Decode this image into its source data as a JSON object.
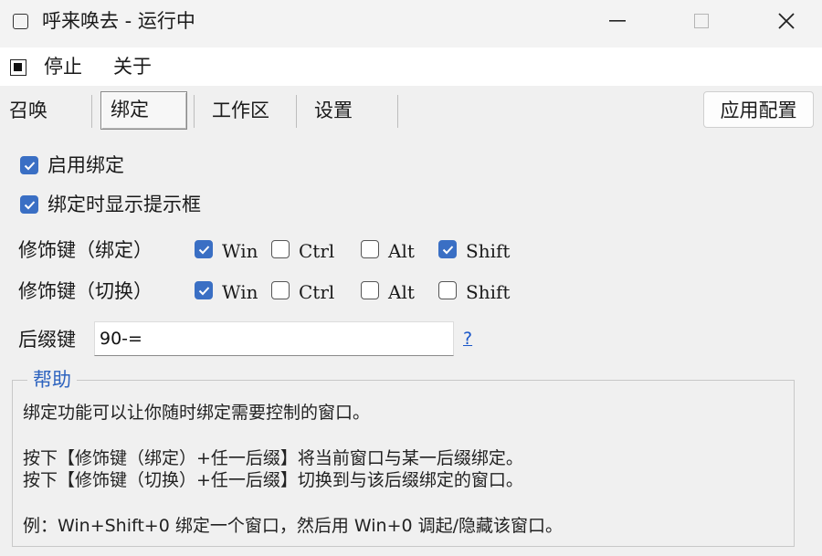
{
  "window": {
    "title": "呼来唤去 - 运行中",
    "minimize_icon": "minimize-icon",
    "maximize_icon": "maximize-icon",
    "close_icon": "close-icon"
  },
  "menu": {
    "stop_label": "停止",
    "about_label": "关于"
  },
  "tabs": [
    {
      "label": "召唤",
      "active": false
    },
    {
      "label": "绑定",
      "active": true
    },
    {
      "label": "工作区",
      "active": false
    },
    {
      "label": "设置",
      "active": false
    }
  ],
  "apply_button": "应用配置",
  "options": {
    "enable_bind": {
      "label": "启用绑定",
      "checked": true
    },
    "show_tip": {
      "label": "绑定时显示提示框",
      "checked": true
    }
  },
  "modifier_bind": {
    "label": "修饰键（绑定）",
    "keys": [
      {
        "name": "Win",
        "checked": true
      },
      {
        "name": "Ctrl",
        "checked": false
      },
      {
        "name": "Alt",
        "checked": false
      },
      {
        "name": "Shift",
        "checked": true
      }
    ]
  },
  "modifier_switch": {
    "label": "修饰键（切换）",
    "keys": [
      {
        "name": "Win",
        "checked": true
      },
      {
        "name": "Ctrl",
        "checked": false
      },
      {
        "name": "Alt",
        "checked": false
      },
      {
        "name": "Shift",
        "checked": false
      }
    ]
  },
  "suffix": {
    "label": "后缀键",
    "value": "90-=",
    "help_link": "?"
  },
  "help": {
    "title": "帮助",
    "line1": "绑定功能可以让你随时绑定需要控制的窗口。",
    "line2": "按下【修饰键（绑定）+任一后缀】将当前窗口与某一后缀绑定。",
    "line3": "按下【修饰键（切换）+任一后缀】切换到与该后缀绑定的窗口。",
    "line4": "例：Win+Shift+0 绑定一个窗口，然后用 Win+0 调起/隐藏该窗口。"
  },
  "colors": {
    "accent": "#3a6fc4",
    "link": "#1a56c8",
    "group_title": "#2d63bf"
  }
}
